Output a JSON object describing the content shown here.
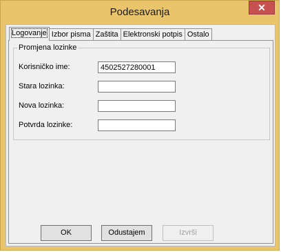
{
  "window": {
    "title": "Podesavanja",
    "close_glyph": "✕"
  },
  "tabs": [
    {
      "label": "Logovanje",
      "active": true
    },
    {
      "label": "Izbor pisma",
      "active": false
    },
    {
      "label": "Zaštita",
      "active": false
    },
    {
      "label": "Elektronski potpis",
      "active": false
    },
    {
      "label": "Ostalo",
      "active": false
    }
  ],
  "group": {
    "title": "Promjena lozinke",
    "fields": [
      {
        "label": "Korisničko ime:",
        "value": "4502527280001"
      },
      {
        "label": "Stara lozinka:",
        "value": ""
      },
      {
        "label": "Nova lozinka:",
        "value": ""
      },
      {
        "label": "Potvrda lozinke:",
        "value": ""
      }
    ]
  },
  "buttons": {
    "ok": "OK",
    "cancel": "Odustajem",
    "apply": "Izvrši"
  }
}
